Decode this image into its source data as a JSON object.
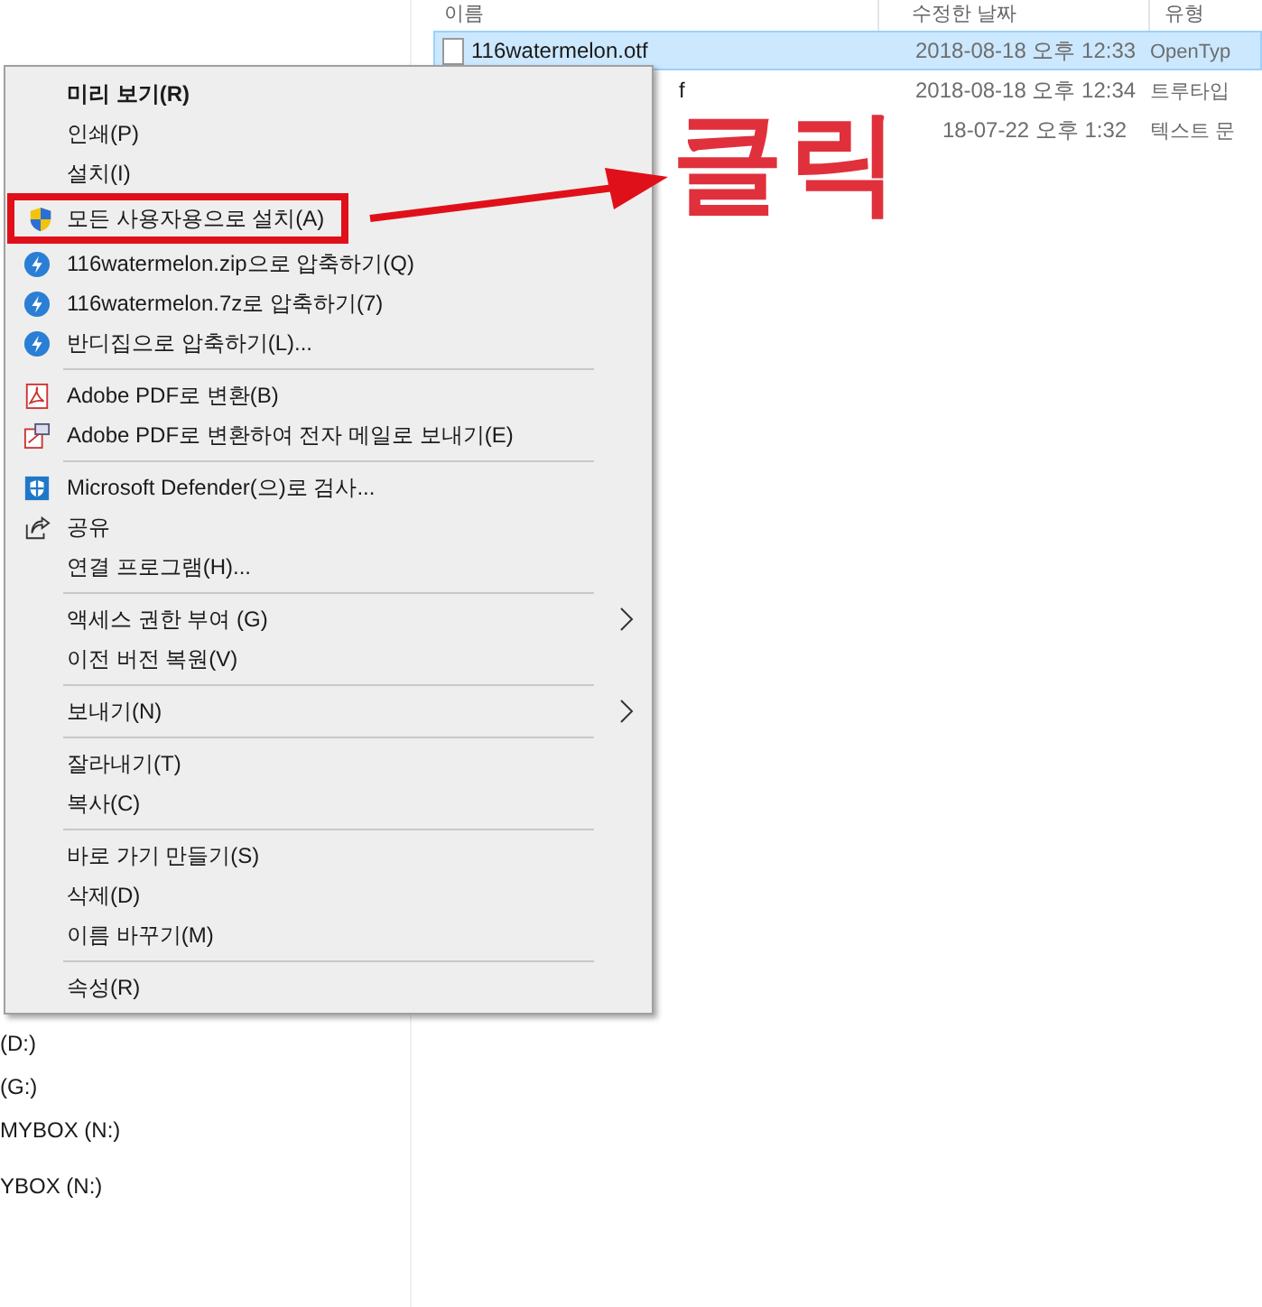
{
  "file_list": {
    "columns": [
      "이름",
      "수정한 날짜",
      "유형"
    ],
    "rows": [
      {
        "name": "116watermelon.otf",
        "date": "2018-08-18 오후 12:33",
        "type": "OpenTyp",
        "selected": true,
        "icon": true
      },
      {
        "name": "f",
        "date": "2018-08-18 오후 12:34",
        "type": "트루타입",
        "selected": false,
        "icon": false
      },
      {
        "date": "18-07-22 오후 1:32",
        "type": "텍스트 문",
        "selected": false,
        "icon": false
      }
    ]
  },
  "nav_pane": {
    "items": [
      "(D:)",
      "(G:)",
      "MYBOX (N:)",
      "YBOX (N:)"
    ]
  },
  "context_menu": {
    "items": [
      {
        "kind": "item",
        "label": "미리 보기(R)",
        "bold": true
      },
      {
        "kind": "item",
        "label": "인쇄(P)"
      },
      {
        "kind": "item",
        "label": "설치(I)"
      },
      {
        "kind": "item",
        "label": "모든 사용자용으로 설치(A)",
        "boxed": true
      },
      {
        "kind": "item",
        "label": "116watermelon.zip으로 압축하기(Q)"
      },
      {
        "kind": "item",
        "label": "116watermelon.7z로 압축하기(7)"
      },
      {
        "kind": "item",
        "label": "반디집으로 압축하기(L)..."
      },
      {
        "kind": "separator"
      },
      {
        "kind": "item",
        "label": "Adobe PDF로 변환(B)"
      },
      {
        "kind": "item",
        "label": "Adobe PDF로 변환하여 전자 메일로 보내기(E)"
      },
      {
        "kind": "separator"
      },
      {
        "kind": "item",
        "label": "Microsoft Defender(으)로 검사..."
      },
      {
        "kind": "item",
        "label": "공유"
      },
      {
        "kind": "item",
        "label": "연결 프로그램(H)..."
      },
      {
        "kind": "separator"
      },
      {
        "kind": "item",
        "label": "액세스 권한 부여 (G)",
        "submenu": true
      },
      {
        "kind": "item",
        "label": "이전 버전 복원(V)"
      },
      {
        "kind": "separator"
      },
      {
        "kind": "item",
        "label": "보내기(N)",
        "submenu": true
      },
      {
        "kind": "separator"
      },
      {
        "kind": "item",
        "label": "잘라내기(T)"
      },
      {
        "kind": "item",
        "label": "복사(C)"
      },
      {
        "kind": "separator"
      },
      {
        "kind": "item",
        "label": "바로 가기 만들기(S)"
      },
      {
        "kind": "item",
        "label": "삭제(D)"
      },
      {
        "kind": "item",
        "label": "이름 바꾸기(M)"
      },
      {
        "kind": "separator"
      },
      {
        "kind": "item",
        "label": "속성(R)"
      }
    ]
  },
  "annotation": {
    "text": "클릭"
  }
}
